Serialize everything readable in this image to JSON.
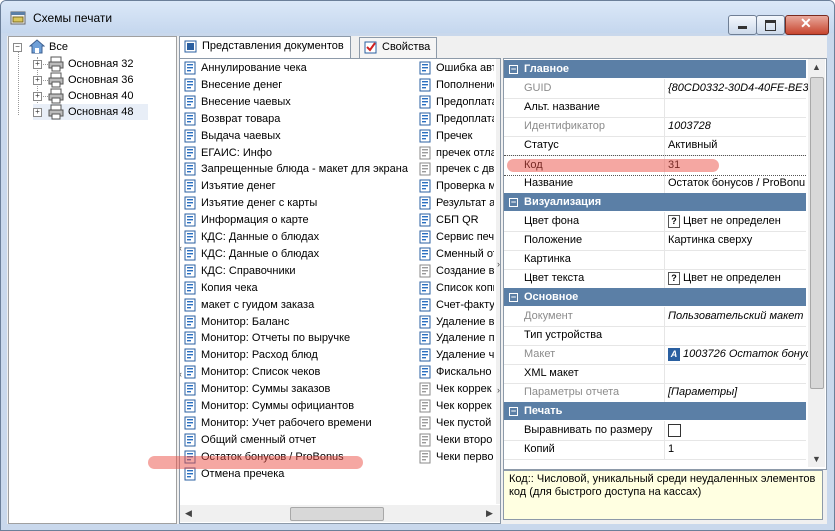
{
  "window": {
    "title": "Схемы печати",
    "controls": {
      "minimize": "minimize",
      "maximize": "maximize",
      "close": "✕"
    }
  },
  "tree": {
    "root": {
      "label": "Все",
      "expander": "⊟"
    },
    "children": [
      {
        "label": "Основная 32",
        "expander": "+"
      },
      {
        "label": "Основная 36",
        "expander": "+"
      },
      {
        "label": "Основная 40",
        "expander": "+"
      },
      {
        "label": "Основная 48",
        "expander": "+",
        "selected": true
      }
    ]
  },
  "tabs": [
    {
      "label": "Представления документов",
      "active": true
    },
    {
      "label": "Свойства",
      "active": false
    }
  ],
  "docs": {
    "col1": [
      "Аннулирование чека",
      "Внесение денег",
      "Внесение чаевых",
      "Возврат товара",
      "Выдача чаевых",
      "ЕГАИС: Инфо",
      "Запрещенные блюда - макет для экрана",
      "Изъятие денег",
      "Изъятие денег с карты",
      "Информация о карте",
      "КДС: Данные о блюдах",
      "КДС: Данные о блюдах",
      "КДС: Справочники",
      "Копия чека",
      "макет с гуидом заказа",
      "Монитор: Баланс",
      "Монитор: Отчеты по выручке",
      "Монитор: Расход блюд",
      "Монитор: Список чеков",
      "Монитор: Суммы заказов",
      "Монитор: Суммы официантов",
      "Монитор: Учет рабочего времени",
      "Общий сменный отчет",
      "Остаток бонусов / ProBonus",
      "Отмена пречека"
    ],
    "col2": [
      "Ошибка авт",
      "Пополнение",
      "Предоплата",
      "Предоплата",
      "Пречек",
      "пречек отла",
      "пречек с дв",
      "Проверка м",
      "Результат а",
      "СБП QR",
      "Сервис печа",
      "Сменный от",
      "Создание ве",
      "Список копи",
      "Счет-фактур",
      "Удаление в",
      "Удаление п",
      "Удаление ч",
      "Фискально",
      "Чек коррек",
      "Чек коррек",
      "Чек пустой",
      "Чеки второ",
      "Чеки перво"
    ],
    "col2_gray_from": 5,
    "col2_gray_set": [
      5,
      6,
      12,
      19,
      20,
      21,
      22,
      23
    ]
  },
  "properties": {
    "categories": [
      {
        "name": "Главное",
        "rows": [
          {
            "name": "GUID",
            "value": "{80CD0332-30D4-40FE-BE3",
            "disabled": true,
            "italic": true
          },
          {
            "name": "Альт. название",
            "value": "",
            "disabled": false
          },
          {
            "name": "Идентификатор",
            "value": "1003728",
            "disabled": true,
            "italic": true
          },
          {
            "name": "Статус",
            "value": "Активный",
            "disabled": false
          },
          {
            "name": "Код",
            "value": "31",
            "disabled": false,
            "selected": true
          },
          {
            "name": "Название",
            "value": "Остаток бонусов / ProBonu",
            "disabled": false
          }
        ]
      },
      {
        "name": "Визуализация",
        "rows": [
          {
            "name": "Цвет фона",
            "value": "Цвет не определен",
            "qbox": "?"
          },
          {
            "name": "Положение",
            "value": "Картинка сверху"
          },
          {
            "name": "Картинка",
            "value": ""
          },
          {
            "name": "Цвет текста",
            "value": "Цвет не определен",
            "qbox": "?"
          }
        ]
      },
      {
        "name": "Основное",
        "rows": [
          {
            "name": "Документ",
            "value": "Пользовательский макет",
            "disabled": true,
            "italic": true
          },
          {
            "name": "Тип устройства",
            "value": ""
          },
          {
            "name": "Макет",
            "value": "1003726 Остаток бонус",
            "disabled": true,
            "italic": true,
            "tagbox": "A"
          },
          {
            "name": "XML макет",
            "value": ""
          },
          {
            "name": "Параметры отчета",
            "value": "[Параметры]",
            "disabled": true,
            "italic": true
          }
        ]
      },
      {
        "name": "Печать",
        "rows": [
          {
            "name": "Выравнивать по размеру",
            "value": "",
            "checkbox": true
          },
          {
            "name": "Копий",
            "value": "1"
          }
        ]
      }
    ],
    "description": "Код:: Числовой, уникальный среди неудаленных элементов код (для быстрого доступа на кассах)"
  },
  "accent_colors": {
    "category_header": "#5b7fa6",
    "highlight": "#eb5046",
    "tooltip_bg": "#ffffe1"
  }
}
